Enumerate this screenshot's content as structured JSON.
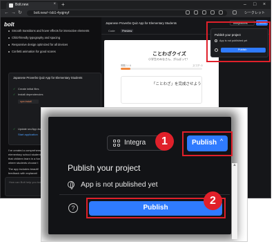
{
  "browser": {
    "tab_title": "Bolt.new",
    "url": "bolt.new/~/sb1-4yqjmyf",
    "secret_label": "シークレット"
  },
  "app": {
    "logo": "bolt",
    "chat_bullets": [
      "Smooth transitions and hover effects for interactive elements",
      "Child-friendly typography and spacing",
      "Responsive design optimized for all devices",
      "Confetti animation for good scores"
    ],
    "card": {
      "title": "Japanese Proverbs Quiz App for Elementary Students",
      "steps": [
        "Create initial files",
        "Install dependencies",
        "Update src/App.tsx",
        "Start application"
      ],
      "cmd": "npm install"
    },
    "chat_paragraphs": [
      "I've created a comprehensive",
      "elementary school student",
      "that children learn in a fun",
      "where students choose t",
      "The app includes beautif",
      "feedback with explanati"
    ],
    "prompt_placeholder": "How can Bolt help you today?",
    "workbench_title": "Japanese Proverbs Quiz App for Elementary Students",
    "tabs": [
      "Code",
      "Preview"
    ],
    "preview": {
      "title": "ことわざクイズ",
      "subtitle": "小学生のみなさん、がんばって！",
      "progress_left": "問題 1 / 6",
      "progress_right": "スコア: 0",
      "progress": 0.12,
      "card_text": "「ことわざ」を完成させよう"
    }
  },
  "mini_popup": {
    "integrations": "Integrations",
    "publish": "Publish",
    "title": "Publish your project",
    "status": "App is not published yet",
    "button": "Publish"
  },
  "zoom": {
    "integrations_label": "Integra",
    "publish_label": "Publish",
    "chevron": "^",
    "popup_title": "Publish your project",
    "status": "App is not published yet",
    "help": "?",
    "button": "Publish",
    "badge1": "1",
    "badge2": "2"
  },
  "colors": {
    "accent": "#2f7bff",
    "highlight": "#e0202a",
    "dark_bg": "#121316"
  }
}
